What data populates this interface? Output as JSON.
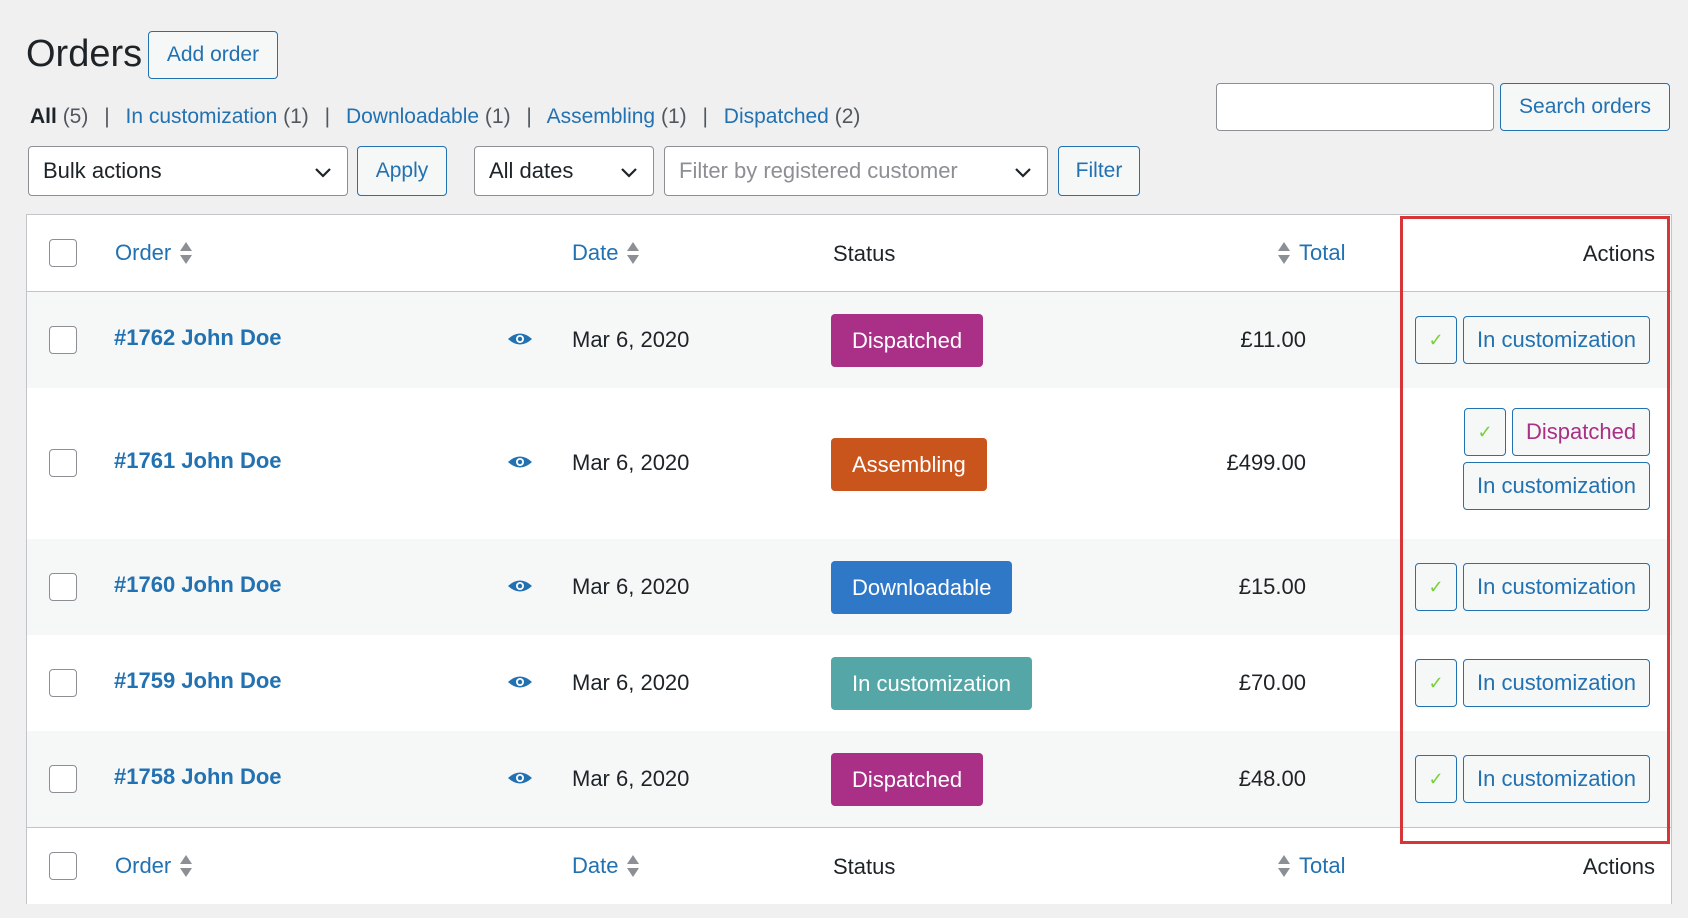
{
  "header": {
    "title": "Orders",
    "add_order_label": "Add order"
  },
  "views": [
    {
      "label": "All",
      "count": "(5)",
      "current": true
    },
    {
      "label": "In customization",
      "count": "(1)"
    },
    {
      "label": "Downloadable",
      "count": "(1)"
    },
    {
      "label": "Assembling",
      "count": "(1)"
    },
    {
      "label": "Dispatched",
      "count": "(2)"
    }
  ],
  "view_separator": "|",
  "search": {
    "value": "",
    "button_label": "Search orders"
  },
  "filters": {
    "bulk_actions": "Bulk actions",
    "apply_label": "Apply",
    "dates": "All dates",
    "customer_placeholder": "Filter by registered customer",
    "filter_label": "Filter"
  },
  "table": {
    "headers": {
      "order": "Order",
      "date": "Date",
      "status": "Status",
      "total": "Total",
      "actions": "Actions"
    },
    "rows": [
      {
        "order": "#1762 John Doe",
        "date": "Mar 6, 2020",
        "status": "Dispatched",
        "status_color": "#aa2f87",
        "total": "£11.00",
        "actions": [
          "✓",
          "In customization"
        ]
      },
      {
        "order": "#1761 John Doe",
        "date": "Mar 6, 2020",
        "status": "Assembling",
        "status_color": "#c9541c",
        "total": "£499.00",
        "actions": [
          "✓",
          "Dispatched",
          "In customization"
        ]
      },
      {
        "order": "#1760 John Doe",
        "date": "Mar 6, 2020",
        "status": "Downloadable",
        "status_color": "#2f78c8",
        "total": "£15.00",
        "actions": [
          "✓",
          "In customization"
        ]
      },
      {
        "order": "#1759 John Doe",
        "date": "Mar 6, 2020",
        "status": "In customization",
        "status_color": "#55a6a6",
        "total": "£70.00",
        "actions": [
          "✓",
          "In customization"
        ]
      },
      {
        "order": "#1758 John Doe",
        "date": "Mar 6, 2020",
        "status": "Dispatched",
        "status_color": "#aa2f87",
        "total": "£48.00",
        "actions": [
          "✓",
          "In customization"
        ]
      }
    ]
  },
  "colors": {
    "accent": "#2271b1",
    "highlight": "#d63638",
    "check": "#7ad03a"
  }
}
